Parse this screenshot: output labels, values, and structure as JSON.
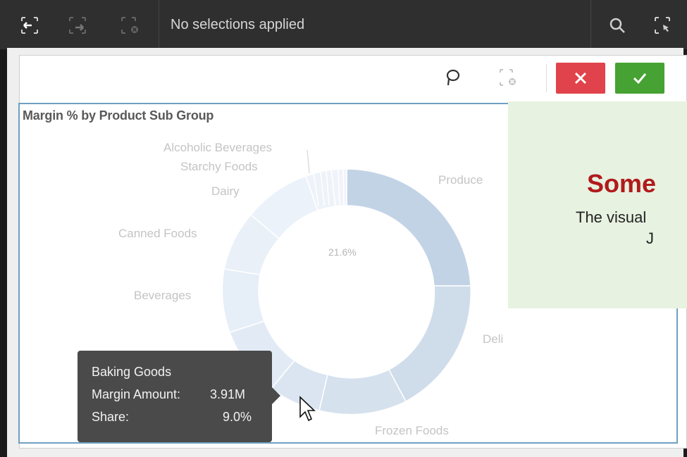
{
  "toolbar": {
    "selection_status": "No selections applied",
    "icons": [
      "back-selection-icon",
      "forward-selection-icon",
      "clear-selections-icon",
      "search-icon",
      "selections-tool-icon"
    ]
  },
  "selection_tools": {
    "icons": [
      "lasso-icon",
      "clear-selection-icon"
    ],
    "cancel": "cancel-icon",
    "confirm": "confirm-icon",
    "colors": {
      "cancel": "#e0434b",
      "confirm": "#46a232"
    }
  },
  "chart_data": {
    "type": "pie",
    "title": "Margin % by Product Sub Group",
    "donut": true,
    "slices": [
      {
        "label": "Produce",
        "share": 21.6
      },
      {
        "label": "Deli"
      },
      {
        "label": "Frozen Foods"
      },
      {
        "label": "Baking Goods",
        "share": 9.0,
        "margin_amount": "3.91M"
      },
      {
        "label": "Beverages"
      },
      {
        "label": "Canned Foods"
      },
      {
        "label": "Dairy"
      },
      {
        "label": "Starchy Foods"
      },
      {
        "label": "Alcoholic Beverages"
      }
    ],
    "data_label": "21.6%"
  },
  "tooltip": {
    "category": "Baking Goods",
    "margin_label": "Margin Amount:",
    "margin_value": "3.91M",
    "share_label": "Share:",
    "share_value": "9.0%"
  },
  "overlay": {
    "heading": "Some",
    "line1": "The visual",
    "line2": "J"
  }
}
